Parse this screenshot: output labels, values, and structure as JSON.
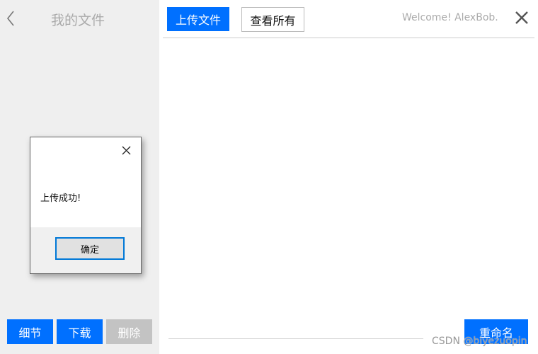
{
  "sidebar": {
    "title": "我的文件",
    "buttons": {
      "details": "细节",
      "download": "下载",
      "delete": "删除"
    }
  },
  "header": {
    "upload": "上传文件",
    "view_all": "查看所有",
    "welcome": "Welcome! AlexBob."
  },
  "footer": {
    "rename": "重命名",
    "watermark": "CSDN @biyezuopin"
  },
  "dialog": {
    "message": "上传成功!",
    "ok": "确定"
  },
  "colors": {
    "accent": "#0070ff",
    "sidebar": "#efefef"
  }
}
